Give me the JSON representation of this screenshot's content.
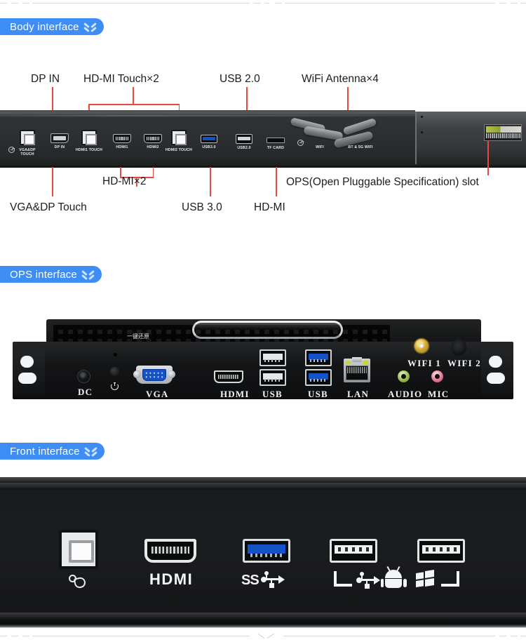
{
  "sections": [
    {
      "id": "body",
      "badge_label": "Body interface",
      "badge_icon": "double-chevron-down-icon"
    },
    {
      "id": "ops",
      "badge_label": "OPS interface",
      "badge_icon": "double-chevron-down-icon"
    },
    {
      "id": "front",
      "badge_label": "Front interface",
      "badge_icon": "double-chevron-down-icon"
    }
  ],
  "colors": {
    "badge_blue": "#3d8df5",
    "leader_red": "#e8483f",
    "usb3_blue": "#1452c8",
    "panel_dark": "#1b1c1e",
    "audio_green": "#9fc053",
    "mic_pink": "#e47c9b",
    "sma_gold": "#d4ae3a"
  },
  "body_interface": {
    "callouts_top": [
      {
        "name": "dp-in",
        "text": "DP IN"
      },
      {
        "name": "hdmi-touch-x2",
        "text": "HD-MI Touch×2"
      },
      {
        "name": "usb-2-0",
        "text": "USB 2.0"
      },
      {
        "name": "wifi-antenna-x4",
        "text": "WiFi Antenna×4"
      }
    ],
    "callouts_bottom": [
      {
        "name": "hdmi-x2",
        "text": "HD-MI×2"
      },
      {
        "name": "ops-slot",
        "text": "OPS(Open Pluggable Specification) slot"
      },
      {
        "name": "vga-dp-touch",
        "text": "VGA&DP Touch"
      },
      {
        "name": "usb-3-0",
        "text": "USB 3.0"
      },
      {
        "name": "hdmi",
        "text": "HD-MI"
      }
    ],
    "port_labels": [
      {
        "name": "vga-dp-touch-port",
        "text": "VGA&DP\nTOUCH"
      },
      {
        "name": "dp-in-port",
        "text": "DP IN"
      },
      {
        "name": "hdmi1-touch-port",
        "text": "HDMI1 TOUCH"
      },
      {
        "name": "hdmi1-port",
        "text": "HDMI1"
      },
      {
        "name": "hdmi2-port",
        "text": "HDMI2"
      },
      {
        "name": "hdmi2-touch-port",
        "text": "HDMI2 TOUCH"
      },
      {
        "name": "usb30-port",
        "text": "USB3.0"
      },
      {
        "name": "usb20-port",
        "text": "USB2.0"
      },
      {
        "name": "tf-card-port",
        "text": "TF CARD"
      },
      {
        "name": "wifi-port",
        "text": "WIFI"
      },
      {
        "name": "bt-5g-wifi-port",
        "text": "BT & 5G WIFI"
      }
    ]
  },
  "ops_interface": {
    "restore_label": "一键还原",
    "labels": [
      {
        "name": "dc-label",
        "text": "DC"
      },
      {
        "name": "vga-label",
        "text": "VGA"
      },
      {
        "name": "hdmi-label",
        "text": "HDMI"
      },
      {
        "name": "usb-label-1",
        "text": "USB"
      },
      {
        "name": "usb-label-2",
        "text": "USB"
      },
      {
        "name": "lan-label",
        "text": "LAN"
      },
      {
        "name": "audio-label",
        "text": "AUDIO"
      },
      {
        "name": "mic-label",
        "text": "MIC"
      },
      {
        "name": "wifi1-label",
        "text": "WIFI 1"
      },
      {
        "name": "wifi2-label",
        "text": "WIFI 2"
      }
    ]
  },
  "front_interface": {
    "hdmi_text": "HDMI",
    "ss_text": "SS",
    "port_names": [
      {
        "name": "usb-b-touch-port",
        "icon": "touch-hand-icon"
      },
      {
        "name": "hdmi-port",
        "icon": "hdmi-text-icon"
      },
      {
        "name": "usb-3-0-port",
        "icon": "superspeed-usb-icon"
      },
      {
        "name": "usb-android-port",
        "icon": "android-icon"
      },
      {
        "name": "usb-windows-port",
        "icon": "windows-icon"
      }
    ]
  }
}
